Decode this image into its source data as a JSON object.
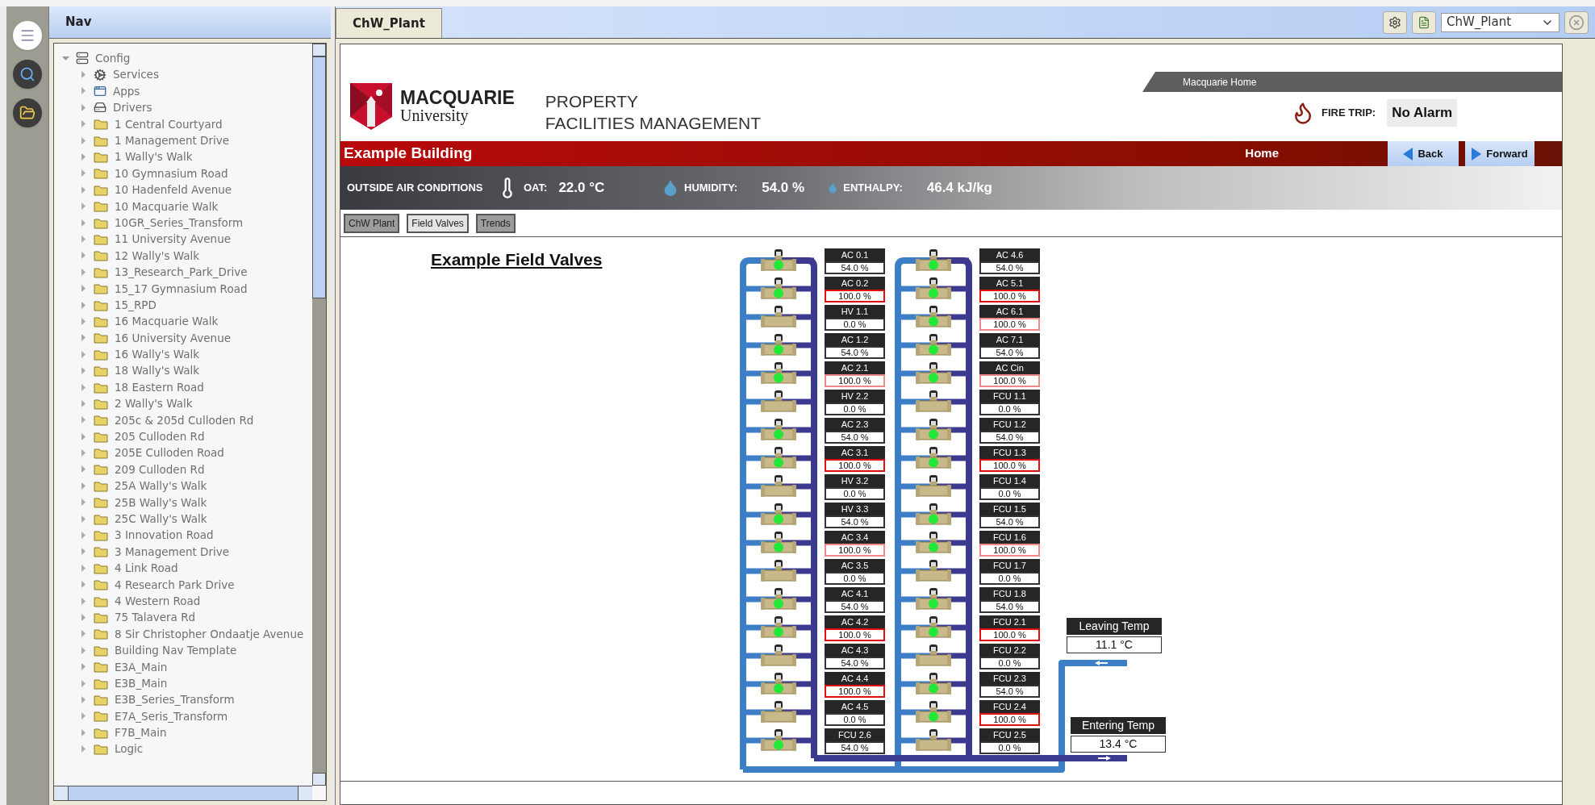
{
  "left_rail": {
    "buttons": [
      {
        "kind": "menu"
      },
      {
        "kind": "search"
      },
      {
        "kind": "folder"
      }
    ]
  },
  "nav": {
    "title": "Nav",
    "tree": {
      "label": "Config",
      "kind": "config",
      "expanded": true,
      "children": [
        {
          "label": "Services",
          "kind": "services",
          "expanded": false
        },
        {
          "label": "Apps",
          "kind": "apps",
          "expanded": false
        },
        {
          "label": "Drivers",
          "kind": "drivers",
          "expanded": false
        },
        {
          "label": "1 Central Courtyard",
          "kind": "folder",
          "expanded": false
        },
        {
          "label": "1 Management Drive",
          "kind": "folder",
          "expanded": false
        },
        {
          "label": "1 Wally's Walk",
          "kind": "folder",
          "expanded": false
        },
        {
          "label": "10 Gymnasium Road",
          "kind": "folder",
          "expanded": false
        },
        {
          "label": "10 Hadenfeld Avenue",
          "kind": "folder",
          "expanded": false
        },
        {
          "label": "10 Macquarie Walk",
          "kind": "folder",
          "expanded": false
        },
        {
          "label": "10GR_Series_Transform",
          "kind": "folder",
          "expanded": false
        },
        {
          "label": "11 University Avenue",
          "kind": "folder",
          "expanded": false
        },
        {
          "label": "12 Wally's Walk",
          "kind": "folder",
          "expanded": false
        },
        {
          "label": "13_Research_Park_Drive",
          "kind": "folder",
          "expanded": false
        },
        {
          "label": "15_17 Gymnasium Road",
          "kind": "folder",
          "expanded": false
        },
        {
          "label": "15_RPD",
          "kind": "folder",
          "expanded": false
        },
        {
          "label": "16 Macquarie Walk",
          "kind": "folder",
          "expanded": false
        },
        {
          "label": "16 University Avenue",
          "kind": "folder",
          "expanded": false
        },
        {
          "label": "16 Wally's Walk",
          "kind": "folder",
          "expanded": false
        },
        {
          "label": "18 Wally's Walk",
          "kind": "folder",
          "expanded": false
        },
        {
          "label": "18 Eastern Road",
          "kind": "folder",
          "expanded": false
        },
        {
          "label": "2 Wally's Walk",
          "kind": "folder",
          "expanded": false
        },
        {
          "label": "205c & 205d Culloden Rd",
          "kind": "folder",
          "expanded": false
        },
        {
          "label": "205 Culloden Rd",
          "kind": "folder",
          "expanded": false
        },
        {
          "label": "205E Culloden Road",
          "kind": "folder",
          "expanded": false
        },
        {
          "label": "209 Culloden Rd",
          "kind": "folder",
          "expanded": false
        },
        {
          "label": "25A Wally's Walk",
          "kind": "folder",
          "expanded": false
        },
        {
          "label": "25B Wally's Walk",
          "kind": "folder",
          "expanded": false
        },
        {
          "label": "25C Wally's Walk",
          "kind": "folder",
          "expanded": false
        },
        {
          "label": "3 Innovation Road",
          "kind": "folder",
          "expanded": false
        },
        {
          "label": "3 Management Drive",
          "kind": "folder",
          "expanded": false
        },
        {
          "label": "4 Link Road",
          "kind": "folder",
          "expanded": false
        },
        {
          "label": "4 Research Park Drive",
          "kind": "folder",
          "expanded": false
        },
        {
          "label": "4 Western Road",
          "kind": "folder",
          "expanded": false
        },
        {
          "label": "75 Talavera Rd",
          "kind": "folder",
          "expanded": false
        },
        {
          "label": "8 Sir Christopher Ondaatje Avenue",
          "kind": "folder",
          "expanded": false
        },
        {
          "label": "Building Nav Template",
          "kind": "folder",
          "expanded": false
        },
        {
          "label": "E3A_Main",
          "kind": "folder",
          "expanded": false
        },
        {
          "label": "E3B_Main",
          "kind": "folder",
          "expanded": false
        },
        {
          "label": "E3B_Series_Transform",
          "kind": "folder",
          "expanded": false
        },
        {
          "label": "E7A_Seris_Transform",
          "kind": "folder",
          "expanded": false
        },
        {
          "label": "F7B_Main",
          "kind": "folder",
          "expanded": false
        },
        {
          "label": "Logic",
          "kind": "folder",
          "expanded": false
        }
      ]
    }
  },
  "view_tabs": [
    {
      "label": "ChW_Plant",
      "selected": true
    }
  ],
  "toolbar": {
    "view_select": "ChW_Plant"
  },
  "header": {
    "org_name": "MACQUARIE",
    "org_sub": "University",
    "dept_lines": [
      "PROPERTY",
      "FACILITIES MANAGEMENT"
    ],
    "home_link": "Macquarie Home",
    "fire_trip": {
      "label": "FIRE TRIP:",
      "value": "No Alarm"
    }
  },
  "building_bar": {
    "title": "Example Building",
    "home": "Home",
    "back": "Back",
    "forward": "Forward"
  },
  "conditions": {
    "title": "OUTSIDE AIR CONDITIONS",
    "readings": [
      {
        "kind": "temperature",
        "label": "OAT:",
        "value": "22.0 °C"
      },
      {
        "kind": "humidity",
        "label": "HUMIDITY:",
        "value": "54.0 %"
      },
      {
        "kind": "enthalpy",
        "label": "ENTHALPY:",
        "value": "46.4 kJ/kg"
      }
    ]
  },
  "page_tabs": [
    {
      "label": "ChW Plant",
      "selected": false
    },
    {
      "label": "Field Valves",
      "selected": true
    },
    {
      "label": "Trends",
      "selected": false
    }
  ],
  "diagram": {
    "title": "Example Field Valves",
    "columns": [
      [
        {
          "label": "AC 0.1",
          "value": "54.0 %",
          "open": true,
          "color": "#333333"
        },
        {
          "label": "AC 0.2",
          "value": "100.0 %",
          "open": true,
          "color": "#e01010"
        },
        {
          "label": "HV 1.1",
          "value": "0.0 %",
          "open": false,
          "color": "#333333"
        },
        {
          "label": "AC 1.2",
          "value": "54.0 %",
          "open": true,
          "color": "#333333"
        },
        {
          "label": "AC 2.1",
          "value": "100.0 %",
          "open": true,
          "color": "#f08a8a"
        },
        {
          "label": "HV 2.2",
          "value": "0.0 %",
          "open": false,
          "color": "#333333"
        },
        {
          "label": "AC 2.3",
          "value": "54.0 %",
          "open": true,
          "color": "#333333"
        },
        {
          "label": "AC 3.1",
          "value": "100.0 %",
          "open": true,
          "color": "#e01010"
        },
        {
          "label": "HV 3.2",
          "value": "0.0 %",
          "open": false,
          "color": "#333333"
        },
        {
          "label": "HV 3.3",
          "value": "54.0 %",
          "open": true,
          "color": "#333333"
        },
        {
          "label": "AC 3.4",
          "value": "100.0 %",
          "open": true,
          "color": "#f08a8a"
        },
        {
          "label": "AC 3.5",
          "value": "0.0 %",
          "open": false,
          "color": "#333333"
        },
        {
          "label": "AC 4.1",
          "value": "54.0 %",
          "open": true,
          "color": "#333333"
        },
        {
          "label": "AC 4.2",
          "value": "100.0 %",
          "open": true,
          "color": "#e01010"
        },
        {
          "label": "AC 4.3",
          "value": "54.0 %",
          "open": false,
          "color": "#333333"
        },
        {
          "label": "AC 4.4",
          "value": "100.0 %",
          "open": true,
          "color": "#e01010"
        },
        {
          "label": "AC 4.5",
          "value": "0.0 %",
          "open": false,
          "color": "#333333"
        },
        {
          "label": "FCU 2.6",
          "value": "54.0 %",
          "open": true,
          "color": "#333333"
        }
      ],
      [
        {
          "label": "AC 4.6",
          "value": "54.0 %",
          "open": true,
          "color": "#333333"
        },
        {
          "label": "AC 5.1",
          "value": "100.0 %",
          "open": true,
          "color": "#e01010"
        },
        {
          "label": "AC 6.1",
          "value": "100.0 %",
          "open": true,
          "color": "#f08a8a"
        },
        {
          "label": "AC 7.1",
          "value": "54.0 %",
          "open": true,
          "color": "#333333"
        },
        {
          "label": "AC Cin",
          "value": "100.0 %",
          "open": true,
          "color": "#f08a8a"
        },
        {
          "label": "FCU 1.1",
          "value": "0.0 %",
          "open": false,
          "color": "#333333"
        },
        {
          "label": "FCU 1.2",
          "value": "54.0 %",
          "open": true,
          "color": "#333333"
        },
        {
          "label": "FCU 1.3",
          "value": "100.0 %",
          "open": true,
          "color": "#e01010"
        },
        {
          "label": "FCU 1.4",
          "value": "0.0 %",
          "open": false,
          "color": "#333333"
        },
        {
          "label": "FCU 1.5",
          "value": "54.0 %",
          "open": true,
          "color": "#333333"
        },
        {
          "label": "FCU 1.6",
          "value": "100.0 %",
          "open": true,
          "color": "#f08a8a"
        },
        {
          "label": "FCU 1.7",
          "value": "0.0 %",
          "open": false,
          "color": "#333333"
        },
        {
          "label": "FCU 1.8",
          "value": "54.0 %",
          "open": true,
          "color": "#333333"
        },
        {
          "label": "FCU 2.1",
          "value": "100.0 %",
          "open": true,
          "color": "#e01010"
        },
        {
          "label": "FCU 2.2",
          "value": "0.0 %",
          "open": false,
          "color": "#333333"
        },
        {
          "label": "FCU 2.3",
          "value": "54.0 %",
          "open": true,
          "color": "#333333"
        },
        {
          "label": "FCU 2.4",
          "value": "100.0 %",
          "open": true,
          "color": "#e01010"
        },
        {
          "label": "FCU 2.5",
          "value": "0.0 %",
          "open": false,
          "color": "#333333"
        }
      ]
    ],
    "temps": [
      {
        "label": "Leaving Temp",
        "value": "11.1 °C"
      },
      {
        "label": "Entering Temp",
        "value": "13.4 °C"
      }
    ]
  }
}
